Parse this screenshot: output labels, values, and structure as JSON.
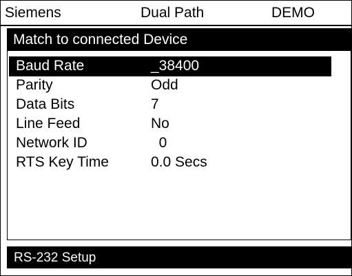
{
  "header": {
    "brand": "Siemens",
    "mode": "Dual Path",
    "state": "DEMO"
  },
  "panel": {
    "title": "Match to connected Device",
    "params": [
      {
        "label": "Baud Rate",
        "value": "_38400",
        "selected": true
      },
      {
        "label": "Parity",
        "value": "Odd",
        "selected": false
      },
      {
        "label": "Data Bits",
        "value": "7",
        "selected": false
      },
      {
        "label": "Line Feed",
        "value": "No",
        "selected": false
      },
      {
        "label": "Network ID",
        "value": "  0",
        "selected": false
      },
      {
        "label": "RTS Key Time",
        "value": "0.0 Secs",
        "selected": false
      }
    ]
  },
  "status_bar": {
    "text": "RS-232 Setup"
  },
  "colors": {
    "background": "#ffffff",
    "foreground": "#000000",
    "highlight_bg": "#000000",
    "highlight_fg": "#ffffff"
  }
}
